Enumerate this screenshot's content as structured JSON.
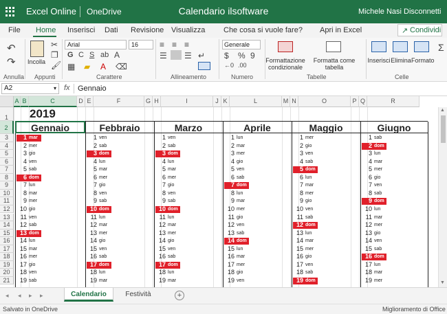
{
  "titlebar": {
    "app_name": "Excel Online",
    "storage": "OneDrive",
    "doc_title": "Calendario ilsoftware",
    "user": "Michele Nasi",
    "logout": "Disconnetti"
  },
  "menu": {
    "items": [
      "File",
      "Home",
      "Inserisci",
      "Dati",
      "Revisione",
      "Visualizza"
    ],
    "active": "Home",
    "tell_me": "Che cosa si vuole fare?",
    "open_in_excel": "Apri in Excel",
    "share": "Condividi"
  },
  "ribbon": {
    "font_name": "Arial",
    "font_size": "16",
    "number_format": "Generale",
    "paste_label": "Incolla",
    "cond_format_label": "Formattazione condizionale",
    "format_table_label": "Formatta come tabella",
    "insert_label": "Inserisci",
    "delete_label": "Elimina",
    "format_label": "Formato",
    "groups": {
      "undo": "Annulla",
      "clipboard": "Appunti",
      "font": "Carattere",
      "align": "Allineamento",
      "number": "Numero",
      "tables": "Tabelle",
      "cells": "Celle"
    },
    "bold": "G",
    "italic": "C",
    "underline": "S",
    "currency": "$",
    "percent": "%",
    "thousands": "9"
  },
  "formula_bar": {
    "cell_ref": "A2",
    "fx": "fx",
    "value": "Gennaio"
  },
  "grid": {
    "columns": [
      "A",
      "B",
      "C",
      "D",
      "E",
      "F",
      "G",
      "H",
      "I",
      "J",
      "K",
      "L",
      "M",
      "N",
      "O",
      "P",
      "Q",
      "R"
    ],
    "selected_columns": [
      "A",
      "B",
      "C"
    ],
    "rows": [
      "1",
      "2",
      "3",
      "4",
      "5",
      "6",
      "7",
      "8",
      "9",
      "10",
      "11",
      "12",
      "13",
      "14",
      "15",
      "16",
      "17",
      "18",
      "19",
      "20",
      "21"
    ],
    "selected_row": "2",
    "year": "2019",
    "holiday_color": "#e0202a",
    "accent_color": "#217346"
  },
  "months": [
    {
      "name": "Gennaio",
      "days": [
        {
          "n": "1",
          "d": "mar",
          "h": true
        },
        {
          "n": "2",
          "d": "mer"
        },
        {
          "n": "3",
          "d": "gio"
        },
        {
          "n": "4",
          "d": "ven"
        },
        {
          "n": "5",
          "d": "sab"
        },
        {
          "n": "6",
          "d": "dom",
          "h": true
        },
        {
          "n": "7",
          "d": "lun"
        },
        {
          "n": "8",
          "d": "mar"
        },
        {
          "n": "9",
          "d": "mer"
        },
        {
          "n": "10",
          "d": "gio"
        },
        {
          "n": "11",
          "d": "ven"
        },
        {
          "n": "12",
          "d": "sab"
        },
        {
          "n": "13",
          "d": "dom",
          "h": true
        },
        {
          "n": "14",
          "d": "lun"
        },
        {
          "n": "15",
          "d": "mar"
        },
        {
          "n": "16",
          "d": "mer"
        },
        {
          "n": "17",
          "d": "gio"
        },
        {
          "n": "18",
          "d": "ven"
        },
        {
          "n": "19",
          "d": "sab"
        }
      ]
    },
    {
      "name": "Febbraio",
      "days": [
        {
          "n": "1",
          "d": "ven"
        },
        {
          "n": "2",
          "d": "sab"
        },
        {
          "n": "3",
          "d": "dom",
          "h": true
        },
        {
          "n": "4",
          "d": "lun"
        },
        {
          "n": "5",
          "d": "mar"
        },
        {
          "n": "6",
          "d": "mer"
        },
        {
          "n": "7",
          "d": "gio"
        },
        {
          "n": "8",
          "d": "ven"
        },
        {
          "n": "9",
          "d": "sab"
        },
        {
          "n": "10",
          "d": "dom",
          "h": true
        },
        {
          "n": "11",
          "d": "lun"
        },
        {
          "n": "12",
          "d": "mar"
        },
        {
          "n": "13",
          "d": "mer"
        },
        {
          "n": "14",
          "d": "gio"
        },
        {
          "n": "15",
          "d": "ven"
        },
        {
          "n": "16",
          "d": "sab"
        },
        {
          "n": "17",
          "d": "dom",
          "h": true
        },
        {
          "n": "18",
          "d": "lun"
        },
        {
          "n": "19",
          "d": "mar"
        }
      ]
    },
    {
      "name": "Marzo",
      "days": [
        {
          "n": "1",
          "d": "ven"
        },
        {
          "n": "2",
          "d": "sab"
        },
        {
          "n": "3",
          "d": "dom",
          "h": true
        },
        {
          "n": "4",
          "d": "lun"
        },
        {
          "n": "5",
          "d": "mar"
        },
        {
          "n": "6",
          "d": "mer"
        },
        {
          "n": "7",
          "d": "gio"
        },
        {
          "n": "8",
          "d": "ven"
        },
        {
          "n": "9",
          "d": "sab"
        },
        {
          "n": "10",
          "d": "dom",
          "h": true
        },
        {
          "n": "11",
          "d": "lun"
        },
        {
          "n": "12",
          "d": "mar"
        },
        {
          "n": "13",
          "d": "mer"
        },
        {
          "n": "14",
          "d": "gio"
        },
        {
          "n": "15",
          "d": "ven"
        },
        {
          "n": "16",
          "d": "sab"
        },
        {
          "n": "17",
          "d": "dom",
          "h": true
        },
        {
          "n": "18",
          "d": "lun"
        },
        {
          "n": "19",
          "d": "mar"
        }
      ]
    },
    {
      "name": "Aprile",
      "days": [
        {
          "n": "1",
          "d": "lun"
        },
        {
          "n": "2",
          "d": "mar"
        },
        {
          "n": "3",
          "d": "mer"
        },
        {
          "n": "4",
          "d": "gio"
        },
        {
          "n": "5",
          "d": "ven"
        },
        {
          "n": "6",
          "d": "sab"
        },
        {
          "n": "7",
          "d": "dom",
          "h": true
        },
        {
          "n": "8",
          "d": "lun"
        },
        {
          "n": "9",
          "d": "mar"
        },
        {
          "n": "10",
          "d": "mer"
        },
        {
          "n": "11",
          "d": "gio"
        },
        {
          "n": "12",
          "d": "ven"
        },
        {
          "n": "13",
          "d": "sab"
        },
        {
          "n": "14",
          "d": "dom",
          "h": true
        },
        {
          "n": "15",
          "d": "lun"
        },
        {
          "n": "16",
          "d": "mar"
        },
        {
          "n": "17",
          "d": "mer"
        },
        {
          "n": "18",
          "d": "gio"
        },
        {
          "n": "19",
          "d": "ven"
        }
      ]
    },
    {
      "name": "Maggio",
      "days": [
        {
          "n": "1",
          "d": "mer"
        },
        {
          "n": "2",
          "d": "gio"
        },
        {
          "n": "3",
          "d": "ven"
        },
        {
          "n": "4",
          "d": "sab"
        },
        {
          "n": "5",
          "d": "dom",
          "h": true
        },
        {
          "n": "6",
          "d": "lun"
        },
        {
          "n": "7",
          "d": "mar"
        },
        {
          "n": "8",
          "d": "mer"
        },
        {
          "n": "9",
          "d": "gio"
        },
        {
          "n": "10",
          "d": "ven"
        },
        {
          "n": "11",
          "d": "sab"
        },
        {
          "n": "12",
          "d": "dom",
          "h": true
        },
        {
          "n": "13",
          "d": "lun"
        },
        {
          "n": "14",
          "d": "mar"
        },
        {
          "n": "15",
          "d": "mer"
        },
        {
          "n": "16",
          "d": "gio"
        },
        {
          "n": "17",
          "d": "ven"
        },
        {
          "n": "18",
          "d": "sab"
        },
        {
          "n": "19",
          "d": "dom",
          "h": true
        }
      ]
    },
    {
      "name": "Giugno",
      "days": [
        {
          "n": "1",
          "d": "sab"
        },
        {
          "n": "2",
          "d": "dom",
          "h": true
        },
        {
          "n": "3",
          "d": "lun"
        },
        {
          "n": "4",
          "d": "mar"
        },
        {
          "n": "5",
          "d": "mer"
        },
        {
          "n": "6",
          "d": "gio"
        },
        {
          "n": "7",
          "d": "ven"
        },
        {
          "n": "8",
          "d": "sab"
        },
        {
          "n": "9",
          "d": "dom",
          "h": true
        },
        {
          "n": "10",
          "d": "lun"
        },
        {
          "n": "11",
          "d": "mar"
        },
        {
          "n": "12",
          "d": "mer"
        },
        {
          "n": "13",
          "d": "gio"
        },
        {
          "n": "14",
          "d": "ven"
        },
        {
          "n": "15",
          "d": "sab"
        },
        {
          "n": "16",
          "d": "dom",
          "h": true
        },
        {
          "n": "17",
          "d": "lun"
        },
        {
          "n": "18",
          "d": "mar"
        },
        {
          "n": "19",
          "d": "mer"
        }
      ]
    }
  ],
  "sheets": {
    "tabs": [
      "Calendario",
      "Festività"
    ],
    "active": "Calendario",
    "add_icon": "plus-icon"
  },
  "status": {
    "left": "Salvato in OneDrive",
    "right": "Miglioramento di Office"
  }
}
